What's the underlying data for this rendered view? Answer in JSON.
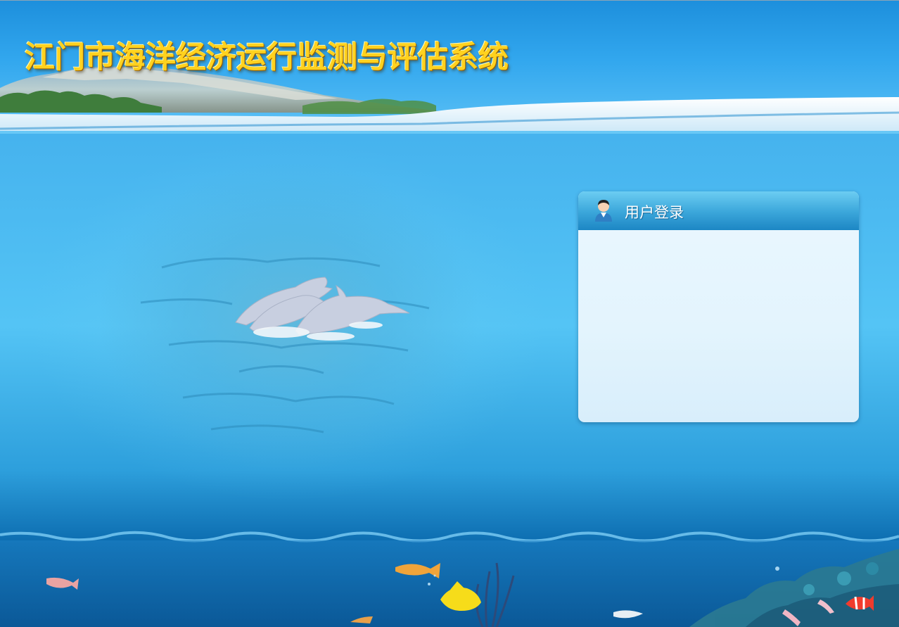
{
  "header": {
    "title": "江门市海洋经济运行监测与评估系统"
  },
  "login": {
    "title": "用户登录",
    "avatar_icon": "user-avatar-icon"
  },
  "colors": {
    "title_gold": "#ffd21f",
    "login_header_blue": "#2a97d0",
    "login_body": "#e3f4fd",
    "sky_blue": "#3aa8e8"
  }
}
